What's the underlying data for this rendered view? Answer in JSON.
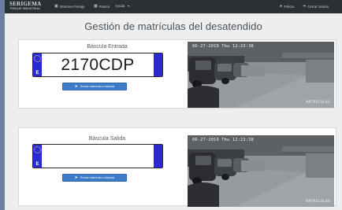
{
  "navbar": {
    "brand_main": "SERIGEMA",
    "brand_sub": "PESAJE INDUSTRIAL",
    "items": [
      {
        "label": "Informes Pesaje",
        "icon": "document-icon"
      },
      {
        "label": "Policía",
        "icon": "camera-icon"
      },
      {
        "label": "Ayuda",
        "icon": "caret-down-icon"
      }
    ],
    "user": {
      "label": "Policia",
      "icon": "user-icon"
    },
    "logout": {
      "label": "Cerrar Sesión",
      "icon": "logout-icon"
    }
  },
  "page": {
    "title": "Gestión de matrículas del desatendido"
  },
  "entry": {
    "title": "Báscula Entrada",
    "plate": {
      "country": "E",
      "number": "2170CDP"
    },
    "button": "Enviar matrícula a báscula",
    "camera": {
      "timestamp": "06-27-2019 Thu 12:23:38",
      "label": "MATRICULAS"
    }
  },
  "exit": {
    "title": "Báscula Salida",
    "plate": {
      "country": "E",
      "number": ""
    },
    "button": "Enviar matrícula a báscula",
    "camera": {
      "timestamp": "06-27-2019 Thu 12:23:38",
      "label": "MATRICULAS"
    }
  },
  "colors": {
    "navbar": "#2b3035",
    "plate_band": "#2b2ad6",
    "button": "#3d7bc9"
  }
}
